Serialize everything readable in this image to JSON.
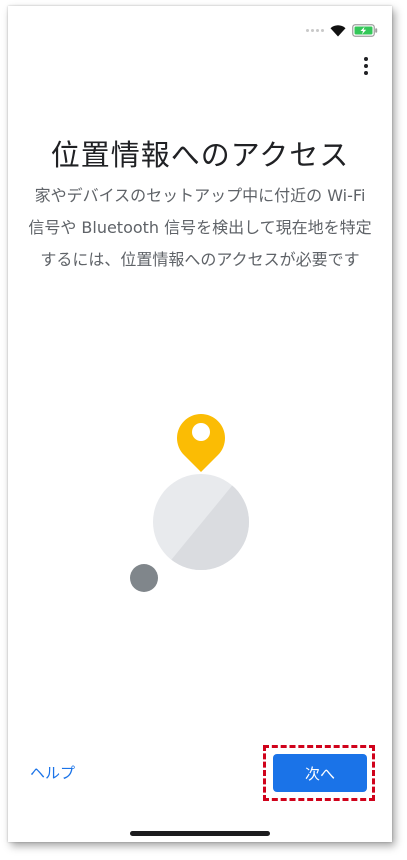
{
  "screen": {
    "title": "位置情報へのアクセス",
    "description": "家やデバイスのセットアップ中に付近の Wi-Fi 信号や Bluetooth 信号を検出して現在地を特定するには、位置情報へのアクセスが必要です"
  },
  "status_bar": {
    "icons": [
      "signal-dots-icon",
      "wifi-icon",
      "battery-charging-icon"
    ],
    "battery_color": "#34c759"
  },
  "toolbar": {
    "menu_icon": "more-vert-icon"
  },
  "illustration": {
    "pin_color": "#fbbc04",
    "circle_color": "#e8eaed",
    "small_dot_color": "#80868b"
  },
  "footer": {
    "help_label": "ヘルプ",
    "next_label": "次へ",
    "accent_color": "#1a73e8",
    "highlight_color": "#d0021b"
  }
}
